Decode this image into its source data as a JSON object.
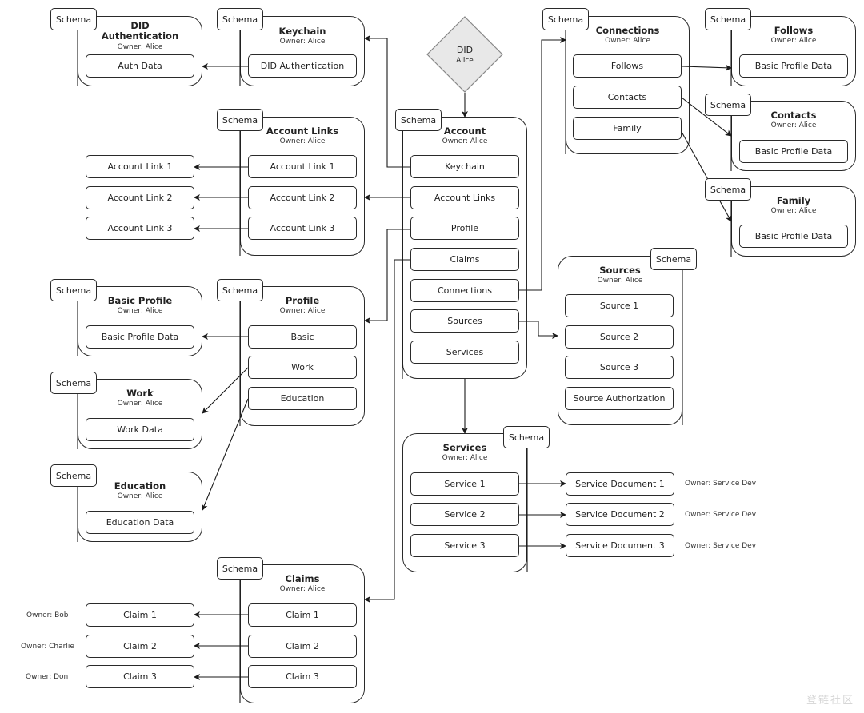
{
  "diagram": {
    "did": {
      "title": "DID",
      "owner": "Alice",
      "fill": "#e8e8e8"
    },
    "schema_label": "Schema",
    "containers": {
      "did_authentication": {
        "title_line1": "DID",
        "title_line2": "Authentication",
        "owner": "Owner: Alice",
        "items": [
          "Auth Data"
        ]
      },
      "keychain": {
        "title": "Keychain",
        "owner": "Owner: Alice",
        "items": [
          "DID Authentication"
        ]
      },
      "account_links": {
        "title": "Account Links",
        "owner": "Owner: Alice",
        "items": [
          "Account Link 1",
          "Account Link 2",
          "Account Link 3"
        ]
      },
      "account": {
        "title": "Account",
        "owner": "Owner: Alice",
        "items": [
          "Keychain",
          "Account Links",
          "Profile",
          "Claims",
          "Connections",
          "Sources",
          "Services"
        ]
      },
      "connections": {
        "title": "Connections",
        "owner": "Owner: Alice",
        "items": [
          "Follows",
          "Contacts",
          "Family"
        ]
      },
      "follows": {
        "title": "Follows",
        "owner": "Owner: Alice",
        "items": [
          "Basic Profile Data"
        ]
      },
      "contacts": {
        "title": "Contacts",
        "owner": "Owner: Alice",
        "items": [
          "Basic Profile Data"
        ]
      },
      "family": {
        "title": "Family",
        "owner": "Owner: Alice",
        "items": [
          "Basic Profile Data"
        ]
      },
      "basic_profile": {
        "title": "Basic Profile",
        "owner": "Owner: Alice",
        "items": [
          "Basic Profile Data"
        ]
      },
      "profile": {
        "title": "Profile",
        "owner": "Owner: Alice",
        "items": [
          "Basic",
          "Work",
          "Education"
        ]
      },
      "work": {
        "title": "Work",
        "owner": "Owner: Alice",
        "items": [
          "Work Data"
        ]
      },
      "education": {
        "title": "Education",
        "owner": "Owner: Alice",
        "items": [
          "Education Data"
        ]
      },
      "sources": {
        "title": "Sources",
        "owner": "Owner: Alice",
        "items": [
          "Source 1",
          "Source 2",
          "Source 3",
          "Source Authorization"
        ]
      },
      "services": {
        "title": "Services",
        "owner": "Owner: Alice",
        "items": [
          "Service 1",
          "Service 2",
          "Service 3"
        ]
      },
      "claims": {
        "title": "Claims",
        "owner": "Owner: Alice",
        "items": [
          "Claim 1",
          "Claim 2",
          "Claim 3"
        ]
      }
    },
    "external_account_links": [
      "Account Link 1",
      "Account Link 2",
      "Account Link 3"
    ],
    "external_claims": [
      {
        "label": "Claim 1",
        "owner": "Owner: Bob"
      },
      {
        "label": "Claim 2",
        "owner": "Owner: Charlie"
      },
      {
        "label": "Claim 3",
        "owner": "Owner: Don"
      }
    ],
    "service_documents": [
      {
        "label": "Service Document 1",
        "owner": "Owner: Service Dev"
      },
      {
        "label": "Service Document 2",
        "owner": "Owner: Service Dev"
      },
      {
        "label": "Service Document 3",
        "owner": "Owner: Service Dev"
      }
    ],
    "watermark": "登链社区",
    "line_color": "#1a1a1a"
  }
}
